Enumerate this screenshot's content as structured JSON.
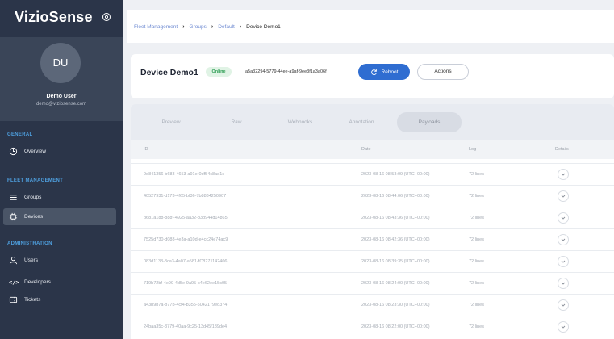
{
  "sidebar": {
    "brand": "VizioSense",
    "avatar_initials": "DU",
    "user_name": "Demo User",
    "user_email": "demo@viziosense.com",
    "sections": {
      "general": "GENERAL",
      "fleet": "FLEET MANAGEMENT",
      "admin": "ADMINISTRATION"
    },
    "items": {
      "overview": "Overview",
      "groups": "Groups",
      "devices": "Devices",
      "users": "Users",
      "developers": "Developers",
      "developers_glyph": "</>",
      "tickets": "Tickets"
    }
  },
  "breadcrumb": {
    "items": [
      "Fleet Management",
      "Groups",
      "Default"
    ],
    "current": "Device Demo1"
  },
  "device": {
    "name": "Device Demo1",
    "status": "Online",
    "uuid": "a5a32294-5779-44ee-a9af-9ee3f1a3a06f"
  },
  "buttons": {
    "reboot": "Reboot",
    "actions": "Actions"
  },
  "tabs": [
    "Preview",
    "Raw",
    "Webhooks",
    "Annotation",
    "Payloads"
  ],
  "active_tab": "Payloads",
  "table": {
    "columns": {
      "id": "ID",
      "date": "Date",
      "log": "Log",
      "details": "Details"
    },
    "rows": [
      {
        "id": "9d841356-b683-4653-a91e-0df54c8ad1c",
        "date": "2023-08-16 08:53:09 (UTC+00:00)",
        "log": "72 lines"
      },
      {
        "id": "40527931-d173-4f65-bf36-7b8834250907",
        "date": "2023-08-16 08:44:06 (UTC+00:00)",
        "log": "72 lines"
      },
      {
        "id": "b681a188-888f-4925-aa32-83b944d14865",
        "date": "2023-08-16 08:43:36 (UTC+00:00)",
        "log": "72 lines"
      },
      {
        "id": "7525d730-d088-4e3a-a10d-e4cc24e74ac9",
        "date": "2023-08-16 08:42:36 (UTC+00:00)",
        "log": "72 lines"
      },
      {
        "id": "083d1133-8ca3-4a07-a581-fC8271142406",
        "date": "2023-08-16 08:39:35 (UTC+00:00)",
        "log": "72 lines"
      },
      {
        "id": "719b72bf-4e99-4d5e-9a95-c4e62ee15c05",
        "date": "2023-08-16 08:24:00 (UTC+00:00)",
        "log": "72 lines"
      },
      {
        "id": "a43b9b7a-b77b-4cf4-b355-5042179ed374",
        "date": "2023-08-16 08:23:30 (UTC+00:00)",
        "log": "72 lines"
      },
      {
        "id": "24baa35c-3779-40aa-9c25-13d45f189de4",
        "date": "2023-08-16 08:22:00 (UTC+00:00)",
        "log": "72 lines"
      }
    ]
  },
  "colors": {
    "sidebar_bg": "#2b3549",
    "accent": "#2f6dd1",
    "section_title": "#4ea0e0",
    "online_badge": "#2f9e55"
  },
  "icons": {
    "settings": "gear-icon",
    "overview": "clock-icon",
    "groups": "list-icon",
    "devices": "chip-icon",
    "users": "users-icon",
    "developers": "code-icon",
    "tickets": "ticket-icon",
    "reboot": "refresh-icon",
    "details": "chevron-down-icon"
  }
}
